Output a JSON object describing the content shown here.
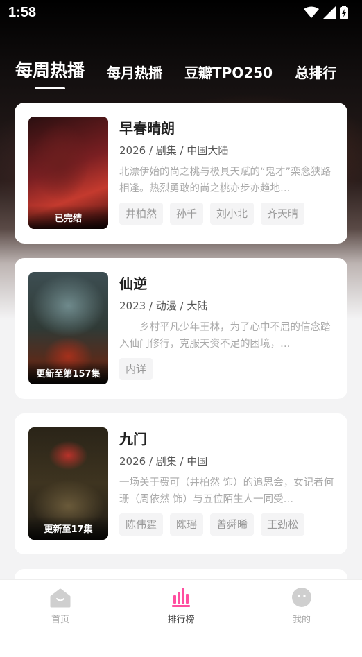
{
  "status_bar": {
    "time": "1:58"
  },
  "tabs": [
    {
      "label": "每周热播",
      "active": true
    },
    {
      "label": "每月热播",
      "active": false
    },
    {
      "label": "豆瓣TPO250",
      "active": false
    },
    {
      "label": "总排行",
      "active": false
    }
  ],
  "items": [
    {
      "title": "早春晴朗",
      "meta": "2026 / 剧集 / 中国大陆",
      "desc": "北漂伊始的尚之桃与极具天赋的“鬼才”栾念狭路相逢。热烈勇敢的尚之桃亦步亦趋地…",
      "poster_label": "已完结",
      "tags": [
        "井柏然",
        "孙千",
        "刘小北",
        "齐天晴"
      ]
    },
    {
      "title": "仙逆",
      "meta": "2023 / 动漫 / 大陆",
      "desc": "　　乡村平凡少年王林，为了心中不屈的信念踏入仙门修行，克服天资不足的困境，…",
      "poster_label": "更新至第157集",
      "tags": [
        "内详"
      ]
    },
    {
      "title": "九门",
      "meta": "2026 / 剧集 / 中国",
      "desc": "一场关于费可（井柏然 饰）的追思会，女记者何珊（周依然 饰）与五位陌生人一同受…",
      "poster_label": "更新至17集",
      "tags": [
        "陈伟霆",
        "陈瑶",
        "曾舜晞",
        "王劲松"
      ]
    }
  ],
  "bottom_nav": [
    {
      "label": "首页",
      "icon": "home-icon",
      "active": false
    },
    {
      "label": "排行榜",
      "icon": "rank-icon",
      "active": true
    },
    {
      "label": "我的",
      "icon": "profile-icon",
      "active": false
    }
  ],
  "colors": {
    "accent": "#ff4fa0",
    "inactive_icon": "#cfcfcf"
  }
}
